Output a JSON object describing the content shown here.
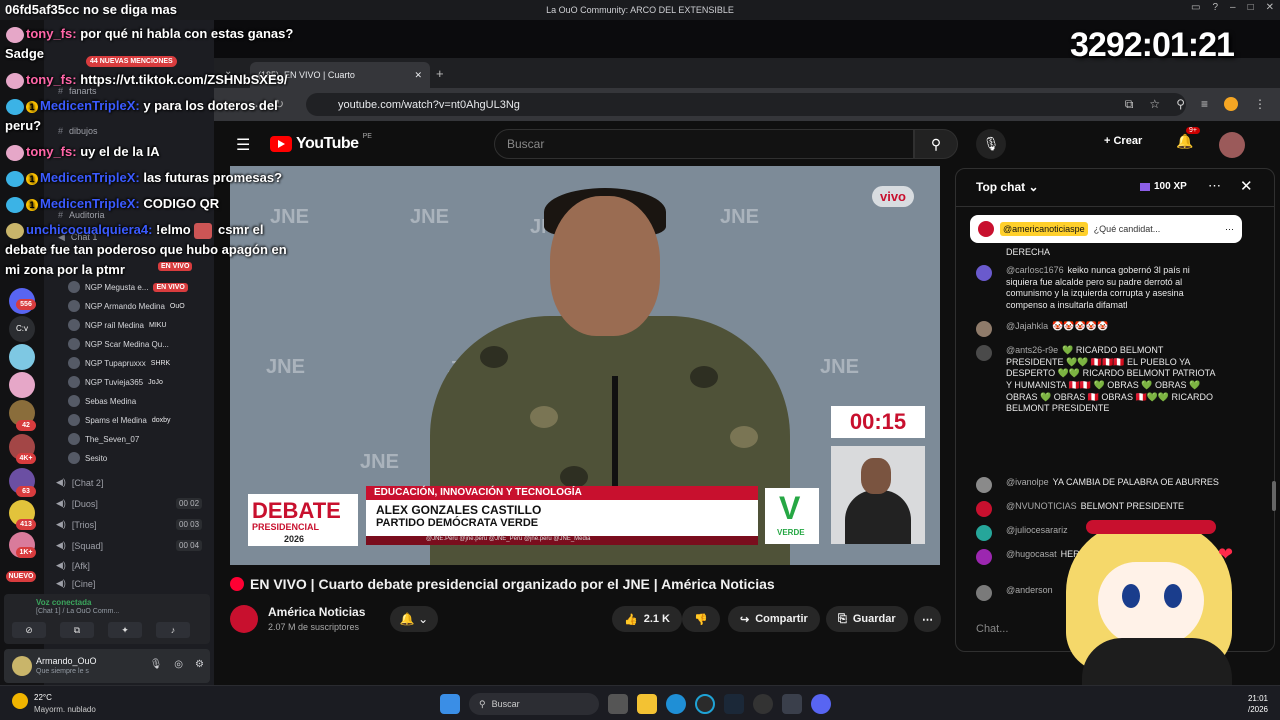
{
  "window": {
    "title": "La OuO Community: ARCO DEL EXTENSIBLE"
  },
  "overlay": {
    "header": "06fd5af35cc no se diga mas",
    "timer": "3292:01:21",
    "mentions": "44 NUEVAS MENCIONES",
    "lines": [
      {
        "user": "tony_fs:",
        "text": "por qué ni habla con estas ganas?"
      },
      {
        "user": "",
        "text": "Sadge"
      },
      {
        "user": "tony_fs:",
        "text": "https://vt.tiktok.com/ZSHNbSXE9/"
      },
      {
        "user": "MedicenTripleX:",
        "text": "y para los doteros del"
      },
      {
        "user": "",
        "text": "peru?"
      },
      {
        "user": "tony_fs:",
        "text": "uy el de la IA"
      },
      {
        "user": "MedicenTripleX:",
        "text": "las futuras promesas?"
      },
      {
        "user": "MedicenTripleX:",
        "text": "CODIGO QR"
      },
      {
        "user": "unchicocualquiera4:",
        "text": "!elmo"
      },
      {
        "user": "",
        "text": "csmr el"
      },
      {
        "user": "",
        "text": "debate fue tan poderoso que hubo apagón en"
      },
      {
        "user": "",
        "text": "mi zona por la ptmr"
      }
    ]
  },
  "discord": {
    "channels": [
      "fanarts",
      "dibujos",
      "Auditoria",
      "Chat 1"
    ],
    "live_label": "EN VIVO",
    "voice_users": [
      {
        "name": "NGP Megusta e...",
        "tag": "EN VIVO"
      },
      {
        "name": "NGP Armando Medina",
        "tag": "OuO"
      },
      {
        "name": "NGP raíl Medina",
        "tag": "MIKU"
      },
      {
        "name": "NGP Scar Medina Qu...",
        "tag": ""
      },
      {
        "name": "NGP Tupapruxxx",
        "tag": "SHRK"
      },
      {
        "name": "NGP Tuvieja365",
        "tag": "JoJo"
      },
      {
        "name": "Sebas Medina",
        "tag": ""
      },
      {
        "name": "Spams el Medina",
        "tag": "doxby"
      },
      {
        "name": "The_Seven_07",
        "tag": ""
      },
      {
        "name": "Sesito",
        "tag": ""
      }
    ],
    "voice_channels": [
      {
        "name": "[Chat 2]",
        "count": ""
      },
      {
        "name": "[Duos]",
        "count": "00 02"
      },
      {
        "name": "[Trios]",
        "count": "00 03"
      },
      {
        "name": "[Squad]",
        "count": "00 04"
      },
      {
        "name": "[Afk]",
        "count": ""
      },
      {
        "name": "[Cine]",
        "count": ""
      }
    ],
    "server_badges": [
      "556",
      "C:v",
      "42",
      "4K+",
      "63",
      "413",
      "1K+",
      "NUEVO"
    ],
    "voice_connected": "Voz conectada",
    "voice_channel_path": "[Chat 1] / La OuO Comm...",
    "user": {
      "name": "Armando_OuO",
      "status": "Que siempre le s"
    }
  },
  "chrome": {
    "tab_count": "(185)",
    "tab_title": "EN VIVO | Cuarto",
    "url": "youtube.com/watch?v=nt0AhgUL3Ng"
  },
  "youtube": {
    "logo": "YouTube",
    "country": "PE",
    "search_placeholder": "Buscar",
    "create_label": "Crear",
    "notif_count": "9+",
    "video": {
      "live_badge": "vivo",
      "watermark": "JNE",
      "countdown": "00:15",
      "lower_band": "EDUCACIÓN, INNOVACIÓN Y TECNOLOGÍA",
      "name": "ALEX GONZALES CASTILLO",
      "party": "PARTIDO DEMÓCRATA VERDE",
      "ticker": "@JNE.Peru   @jne.peru   @JNE_Peru   @jne.peru   @JNE_Media",
      "debate_logo_big": "DEBATE",
      "debate_logo_sub": "PRESIDENCIAL",
      "debate_year": "2026",
      "party_logo_letter": "V",
      "party_logo_text": "VERDE"
    },
    "title": "EN VIVO | Cuarto debate presidencial organizado por el JNE | América Noticias",
    "channel": {
      "name": "América Noticias",
      "subs": "2.07 M de suscriptores"
    },
    "actions": {
      "likes": "2.1 K",
      "share": "Compartir",
      "save": "Guardar"
    },
    "chat": {
      "header": "Top chat",
      "xp": "100 XP",
      "pinned_handle": "@americanoticiaspe",
      "pinned_text": "¿Qué candidat...",
      "input_placeholder": "Chat...",
      "messages": [
        {
          "author": "",
          "text": "DERECHA"
        },
        {
          "author": "@carlosc1676",
          "text": "keiko nunca gobernó 3l país ni siquiera fue alcalde pero su padre derrotó al comunismo y la izquierda corrupta y asesina compenso a insultarla difamatl"
        },
        {
          "author": "@Jajahkla",
          "text": "🤡🤡🤡🤡🤡"
        },
        {
          "author": "@ants26-r9e",
          "text": "💚 RICARDO BELMONT PRESIDENTE 💚💚 🇵🇪🇵🇪🇵🇪 EL PUEBLO YA DESPERTO 💚💚 RICARDO BELMONT PATRIOTA Y HUMANISTA 🇵🇪🇵🇪 💚 OBRAS 💚 OBRAS 💚 OBRAS 💚 OBRAS 🇵🇪 OBRAS 🇵🇪💚💚 RICARDO BELMONT PRESIDENTE"
        },
        {
          "author": "@ivanolpe",
          "text": "YA CAMBIA DE PALABRA OE ABURRES"
        },
        {
          "author": "@NVUNOTICIAS",
          "text": "BELMONT PRESIDENTE"
        },
        {
          "author": "@juliocesarariz",
          "text": ""
        },
        {
          "author": "@hugocasat",
          "text": "HERMANO"
        },
        {
          "author": "@anderson",
          "text": ""
        }
      ]
    }
  },
  "taskbar": {
    "temp": "22°C",
    "weather": "Mayorm. nublado",
    "search": "Buscar",
    "time": "21:01",
    "date": "/2026"
  },
  "colors": {
    "yt_red": "#ff0000",
    "jne_red": "#c8102e",
    "discord_green": "#3ba55d",
    "accent_blue": "#3b5bff"
  }
}
